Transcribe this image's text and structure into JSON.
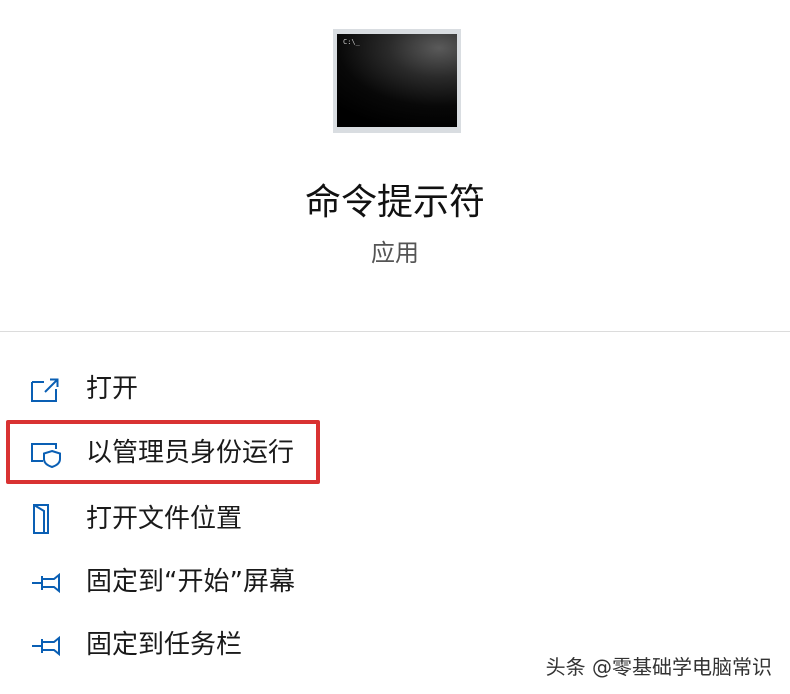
{
  "app": {
    "title": "命令提示符",
    "type": "应用",
    "icon_prompt": "C:\\_"
  },
  "menu": {
    "items": [
      {
        "label": "打开",
        "icon": "open-new-window-icon"
      },
      {
        "label": "以管理员身份运行",
        "icon": "shield-admin-icon",
        "highlighted": true
      },
      {
        "label": "打开文件位置",
        "icon": "file-location-icon"
      },
      {
        "label": "固定到“开始”屏幕",
        "icon": "pin-icon"
      },
      {
        "label": "固定到任务栏",
        "icon": "pin-icon"
      }
    ]
  },
  "watermark": "头条 @零基础学电脑常识",
  "colors": {
    "accent": "#0a5fb4",
    "highlight": "#d93232",
    "background": "#ffffff"
  }
}
